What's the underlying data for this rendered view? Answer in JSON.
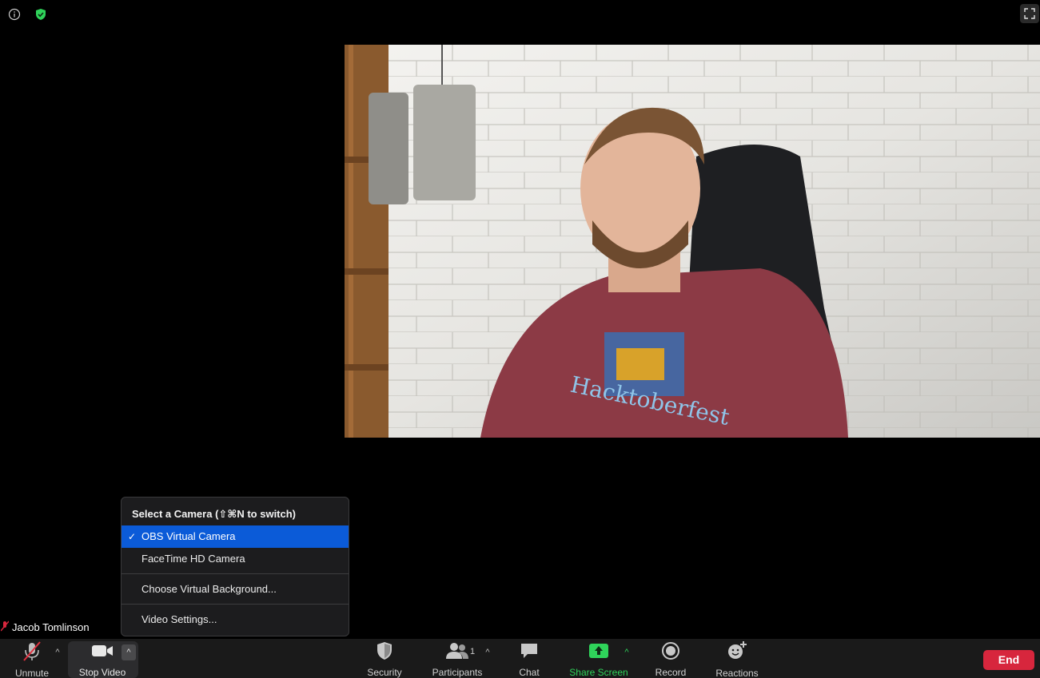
{
  "top": {
    "info_icon": "info-icon",
    "shield_icon": "shield-check-icon",
    "fullscreen_icon": "fullscreen-icon"
  },
  "video": {
    "participant_name": "Jacob Tomlinson"
  },
  "camera_menu": {
    "header": "Select a Camera (⇧⌘N to switch)",
    "cameras": [
      {
        "label": "OBS Virtual Camera",
        "selected": true
      },
      {
        "label": "FaceTime HD Camera",
        "selected": false
      }
    ],
    "check_mark": "✓",
    "virtual_background": "Choose Virtual Background...",
    "video_settings": "Video Settings..."
  },
  "toolbar": {
    "unmute": "Unmute",
    "stop_video": "Stop Video",
    "security": "Security",
    "participants": "Participants",
    "participants_count": "1",
    "chat": "Chat",
    "share_screen": "Share Screen",
    "record": "Record",
    "reactions": "Reactions",
    "end": "End"
  },
  "colors": {
    "accent_green": "#2fd35a",
    "menu_selected": "#0b5bd8",
    "end_red": "#d7263d",
    "toolbar_bg": "#1a1a1a"
  }
}
